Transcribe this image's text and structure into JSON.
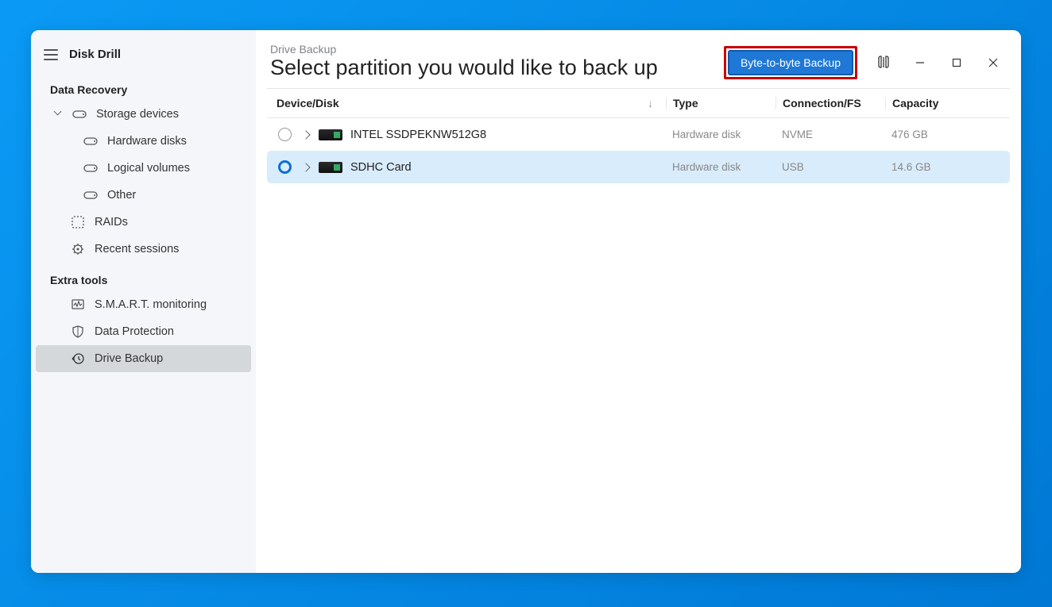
{
  "app_title": "Disk Drill",
  "sidebar": {
    "section1": "Data Recovery",
    "storage_devices": "Storage devices",
    "hardware_disks": "Hardware disks",
    "logical_volumes": "Logical volumes",
    "other": "Other",
    "raids": "RAIDs",
    "recent_sessions": "Recent sessions",
    "section2": "Extra tools",
    "smart": "S.M.A.R.T. monitoring",
    "data_protection": "Data Protection",
    "drive_backup": "Drive Backup"
  },
  "header": {
    "breadcrumb": "Drive Backup",
    "title": "Select partition you would like to back up",
    "backup_btn": "Byte-to-byte Backup"
  },
  "columns": {
    "device": "Device/Disk",
    "type": "Type",
    "connection": "Connection/FS",
    "capacity": "Capacity"
  },
  "rows": [
    {
      "name": "INTEL SSDPEKNW512G8",
      "type": "Hardware disk",
      "conn": "NVME",
      "cap": "476 GB",
      "selected": false
    },
    {
      "name": "SDHC Card",
      "type": "Hardware disk",
      "conn": "USB",
      "cap": "14.6 GB",
      "selected": true
    }
  ]
}
